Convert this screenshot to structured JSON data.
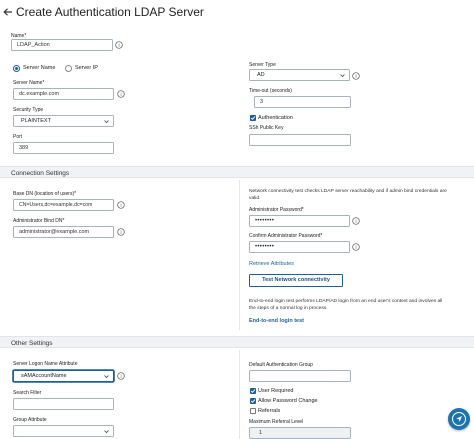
{
  "header": {
    "title": "Create Authentication LDAP Server"
  },
  "name": {
    "label": "Name*",
    "value": "LDAP_Action"
  },
  "server_choice": {
    "option_name": "Server Name",
    "option_ip": "Server IP"
  },
  "server_name": {
    "label": "Server Name*",
    "value": "dc.example.com"
  },
  "security_type": {
    "label": "Security Type",
    "value": "PLAINTEXT"
  },
  "port": {
    "label": "Port",
    "value": "389"
  },
  "server_type": {
    "label": "Server Type",
    "value": "AD"
  },
  "timeout": {
    "label": "Time-out (seconds)",
    "value": "3"
  },
  "authentication": {
    "label": "Authentication"
  },
  "ssh_key": {
    "label": "SSh Public Key",
    "value": ""
  },
  "connection_settings": {
    "title": "Connection Settings",
    "base_dn": {
      "label": "Base DN (location of users)*",
      "value": "CN=Users,dc=example,dc=com"
    },
    "bind_dn": {
      "label": "Administrator Bind DN*",
      "value": "administrator@example.com"
    },
    "connectivity_desc_1": "Network connectivity test checks LDAP server reachability and if admin bind credentials are",
    "connectivity_desc_2": "valid.",
    "admin_password": {
      "label": "Administrator Password*",
      "value": "••••••••"
    },
    "confirm_password": {
      "label": "Confirm Administrator Password*",
      "value": "••••••••"
    },
    "retrieve_attributes": "Retrieve Attributes",
    "test_button": "Test Network connectivity",
    "e2e_desc_1": "End-to-end login test performs LDAP/AD login from an end user's context and involves all",
    "e2e_desc_2": "the steps of a normal log in process.",
    "e2e_link": "End-to-end login test"
  },
  "other_settings": {
    "title": "Other Settings",
    "logon_attr": {
      "label": "Server Logon Name Attribute",
      "value": "sAMAccountName"
    },
    "search_filter": {
      "label": "Search Filter",
      "value": ""
    },
    "group_attr": {
      "label": "Group Attribute",
      "value": ""
    },
    "default_group": {
      "label": "Default Authentication Group",
      "value": ""
    },
    "user_required": "User Required",
    "allow_password_change": "Allow Password Change",
    "referrals": "Referrals",
    "max_referral": {
      "label": "Maximum Referral Level",
      "value": "1"
    }
  },
  "colors": {
    "accent": "#1f5f98",
    "fab": "#1f73ad",
    "section_bg": "#f0f2f5"
  }
}
